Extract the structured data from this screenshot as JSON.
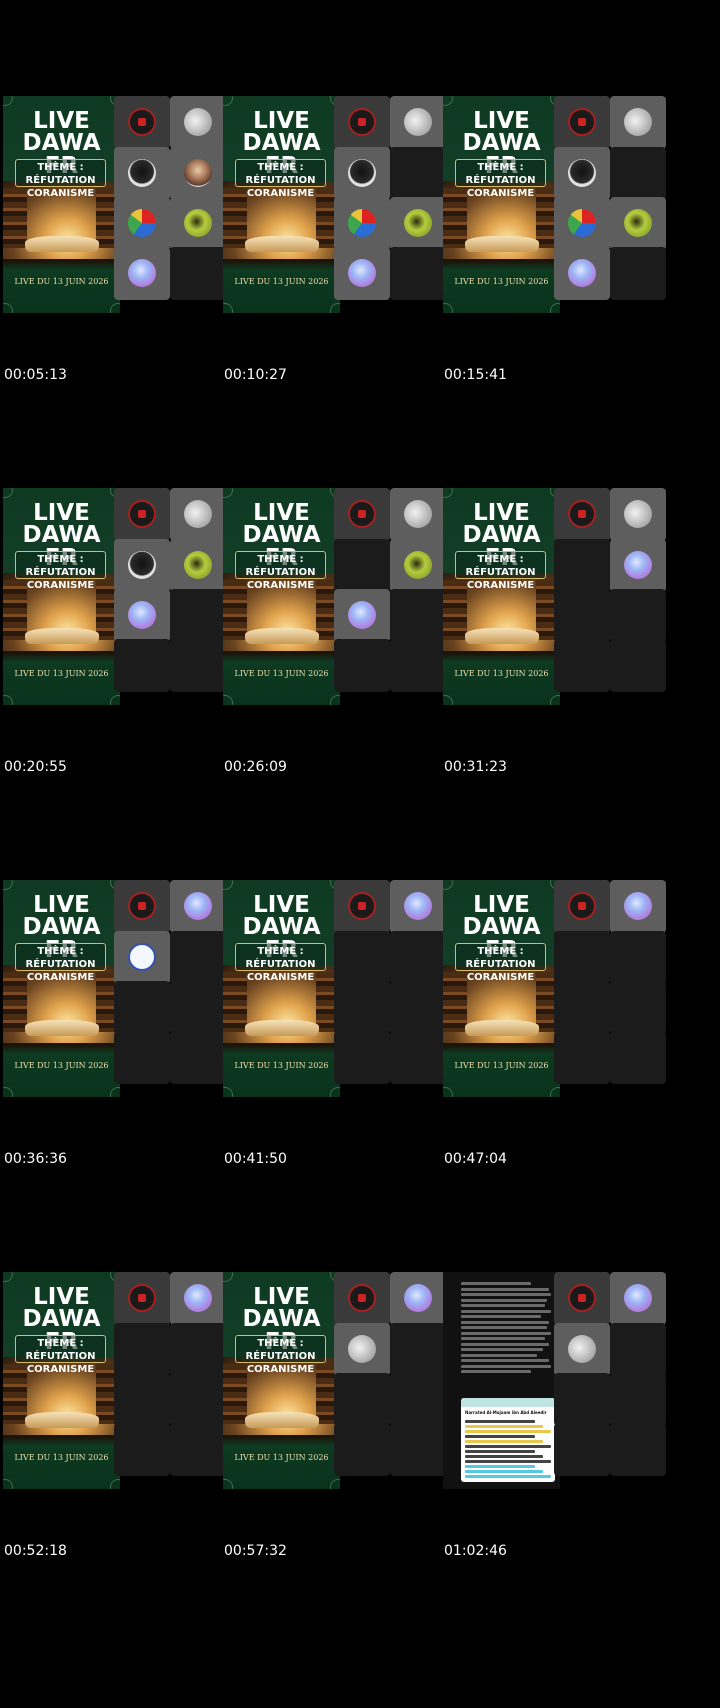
{
  "poster": {
    "title_line1": "LIVE",
    "title_line2": "DAWA FR",
    "theme_line1": "THÈME : RÉFUTATION",
    "theme_line2": "CORANISME",
    "date": "LIVE DU 13 JUIN 2026"
  },
  "frames": [
    {
      "timestamp": "00:05:13",
      "tiles": [
        "logo",
        "wave",
        "black",
        "person",
        "globe",
        "green",
        "pastel",
        "empty"
      ]
    },
    {
      "timestamp": "00:10:27",
      "tiles": [
        "logo",
        "wave",
        "black",
        "empty",
        "globe",
        "green",
        "pastel",
        "empty"
      ]
    },
    {
      "timestamp": "00:15:41",
      "tiles": [
        "logo",
        "wave",
        "black",
        "empty",
        "globe",
        "green",
        "pastel",
        "empty"
      ]
    },
    {
      "timestamp": "00:20:55",
      "tiles": [
        "logo",
        "wave",
        "black",
        "green",
        "pastel",
        "empty",
        "empty",
        "empty"
      ]
    },
    {
      "timestamp": "00:26:09",
      "tiles": [
        "logo",
        "wave",
        "empty",
        "green",
        "pastel",
        "empty",
        "empty",
        "empty"
      ]
    },
    {
      "timestamp": "00:31:23",
      "tiles": [
        "logo",
        "wave",
        "empty",
        "pastel",
        "empty",
        "empty",
        "empty",
        "empty"
      ]
    },
    {
      "timestamp": "00:36:36",
      "tiles": [
        "logo",
        "pastel",
        "calli",
        "empty",
        "empty",
        "empty",
        "empty",
        "empty"
      ]
    },
    {
      "timestamp": "00:41:50",
      "tiles": [
        "logo",
        "pastel",
        "empty",
        "empty",
        "empty",
        "empty",
        "empty",
        "empty"
      ]
    },
    {
      "timestamp": "00:47:04",
      "tiles": [
        "logo",
        "pastel",
        "empty",
        "empty",
        "empty",
        "empty",
        "empty",
        "empty"
      ]
    },
    {
      "timestamp": "00:52:18",
      "tiles": [
        "logo",
        "pastel",
        "empty",
        "empty",
        "empty",
        "empty",
        "empty",
        "empty"
      ]
    },
    {
      "timestamp": "00:57:32",
      "tiles": [
        "logo",
        "pastel",
        "wave",
        "empty",
        "empty",
        "empty",
        "empty",
        "empty"
      ]
    },
    {
      "timestamp": "01:02:46",
      "main": "chat",
      "tiles": [
        "logo",
        "pastel",
        "wave",
        "empty",
        "empty",
        "empty",
        "empty",
        "empty"
      ]
    }
  ],
  "chat": {
    "card_title": "Narrated Al-Mujaam ibn Abd Aleedir"
  }
}
